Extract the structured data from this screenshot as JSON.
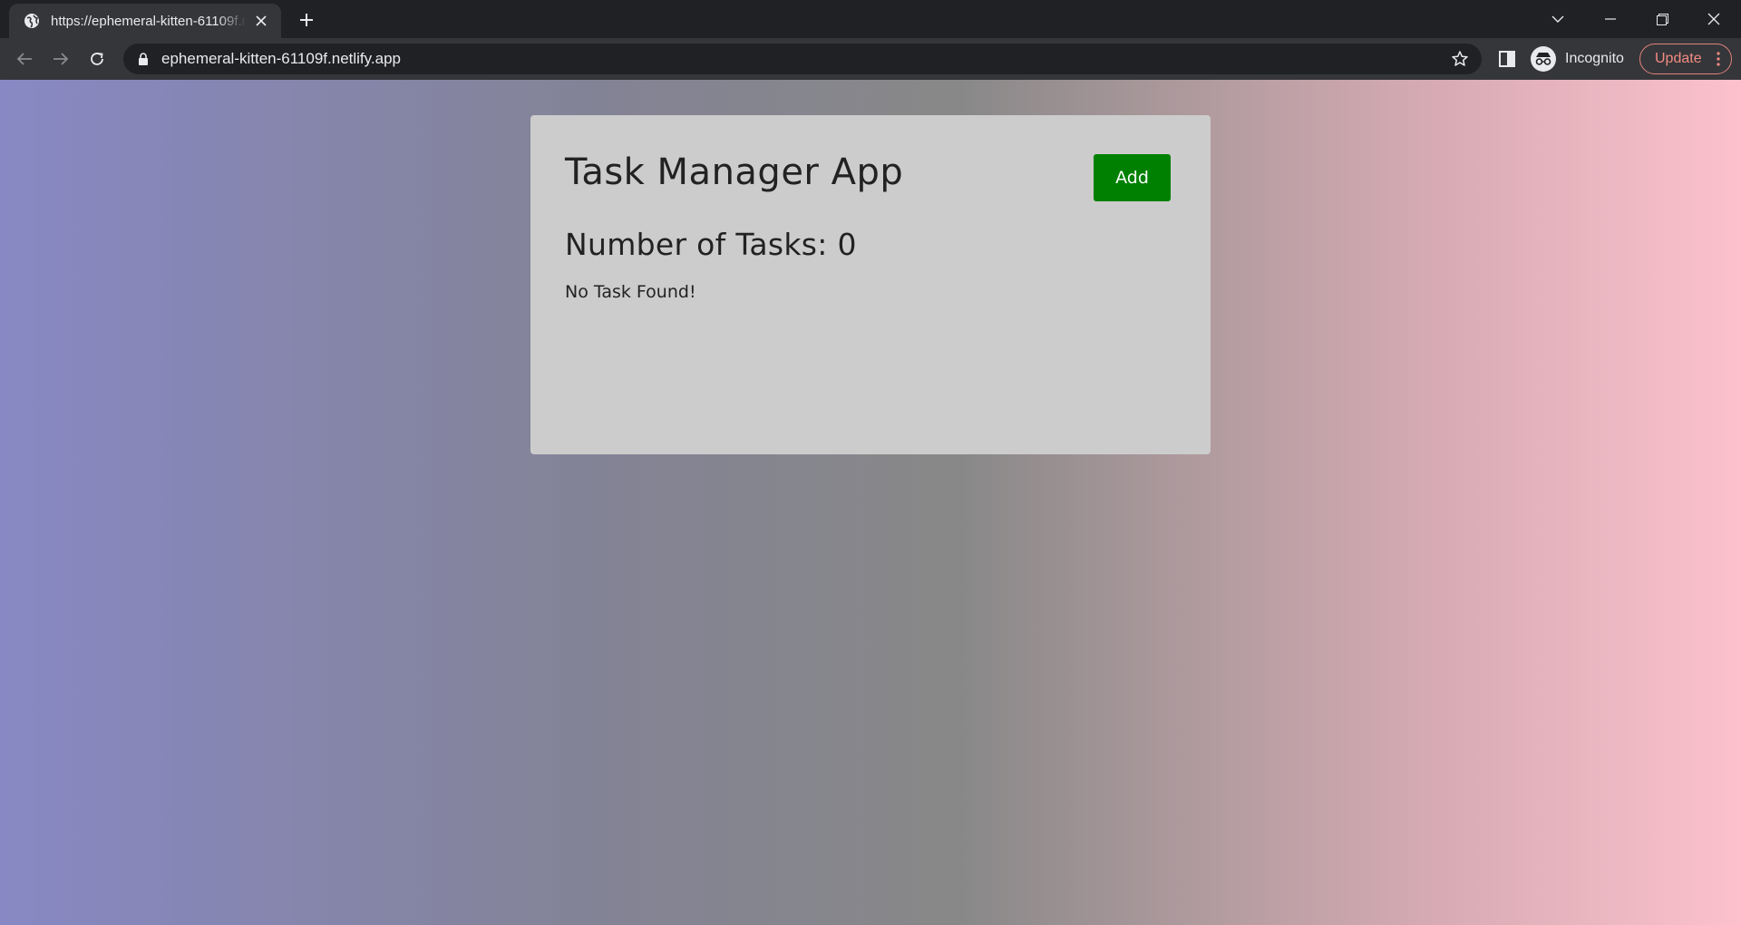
{
  "browser": {
    "tab_title": "https://ephemeral-kitten-61109f.netlify.app",
    "url": "ephemeral-kitten-61109f.netlify.app",
    "profile_label": "Incognito",
    "update_label": "Update",
    "icons": [
      "globe-icon",
      "close-icon",
      "plus-icon",
      "chevron-down-icon",
      "minimize-icon",
      "restore-icon",
      "close-window-icon",
      "back-icon",
      "forward-icon",
      "reload-icon",
      "lock-icon",
      "star-icon",
      "side-panel-icon",
      "incognito-icon",
      "more-vert-icon"
    ]
  },
  "app": {
    "title": "Task Manager App",
    "add_label": "Add",
    "count_label": "Number of Tasks: ",
    "count_value": "0",
    "empty_message": "No Task Found!",
    "colors": {
      "card_background": "#cccccc",
      "add_button": "#008000",
      "gradient_start": "#8888c4",
      "gradient_end": "#fcc1cc"
    }
  }
}
